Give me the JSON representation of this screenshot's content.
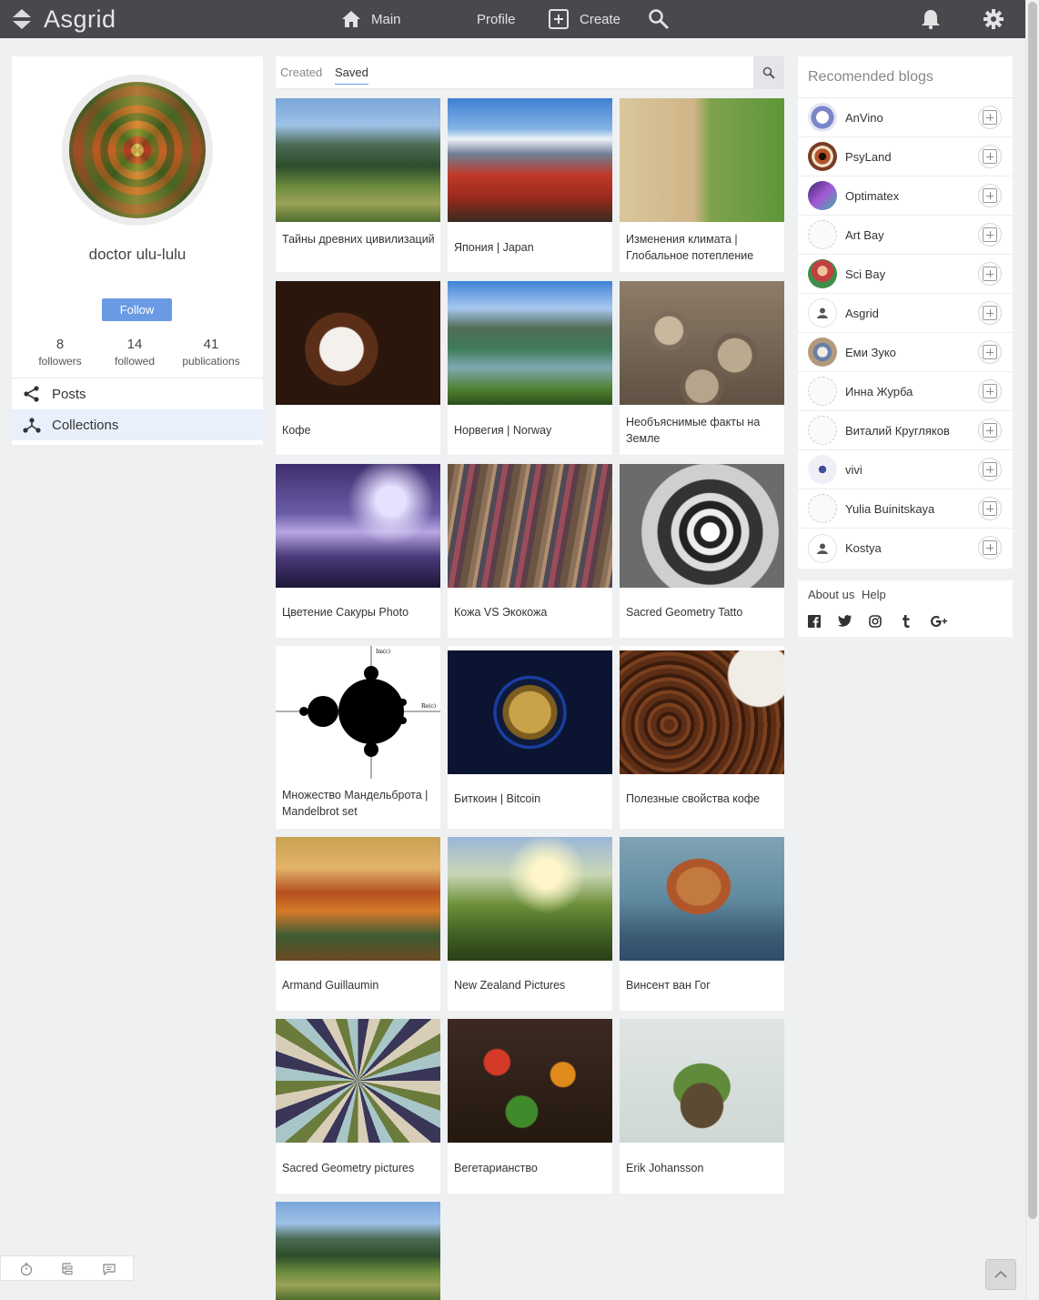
{
  "app": {
    "name": "Asgrid"
  },
  "nav": {
    "main": "Main",
    "profile": "Profile",
    "create": "Create"
  },
  "profile": {
    "name": "doctor ulu-lulu",
    "follow_label": "Follow",
    "stats": [
      {
        "num": "8",
        "label": "followers"
      },
      {
        "num": "14",
        "label": "followed"
      },
      {
        "num": "41",
        "label": "publications"
      }
    ],
    "menu": [
      {
        "label": "Posts",
        "active": false
      },
      {
        "label": "Collections",
        "active": true
      }
    ]
  },
  "tabs": {
    "created": "Created",
    "saved": "Saved",
    "active": "Saved"
  },
  "collections": [
    {
      "caption": "Тайны древних цивилизаций",
      "art": "machu"
    },
    {
      "caption": "Япония | Japan",
      "art": "fuji"
    },
    {
      "caption": "Изменения климата | Глобальное потепление",
      "art": "climate"
    },
    {
      "caption": "Кофе",
      "art": "coffee"
    },
    {
      "caption": "Норвегия | Norway",
      "art": "norway"
    },
    {
      "caption": "Необъяснимые факты на Земле",
      "art": "stones"
    },
    {
      "caption": "Цветение Сакуры Photo",
      "art": "sakura"
    },
    {
      "caption": "Кожа VS Экокожа",
      "art": "leather"
    },
    {
      "caption": "Sacred Geometry Tatto",
      "art": "tattoo"
    },
    {
      "caption": "Множество Мандельброта | Mandelbrot set",
      "art": "mandel"
    },
    {
      "caption": "Биткоин | Bitcoin",
      "art": "bitcoin"
    },
    {
      "caption": "Полезные свойства кофе",
      "art": "beans"
    },
    {
      "caption": "Armand Guillaumin",
      "art": "armand"
    },
    {
      "caption": "New Zealand Pictures",
      "art": "nz"
    },
    {
      "caption": "Винсент ван Гог",
      "art": "vangogh"
    },
    {
      "caption": "Sacred Geometry pictures",
      "art": "geom"
    },
    {
      "caption": "Вегетарианство",
      "art": "veg"
    },
    {
      "caption": "Erik Johansson",
      "art": "erik"
    },
    {
      "caption": "",
      "art": "machu"
    }
  ],
  "mandelbrot_axis": {
    "im": "Im(c)",
    "re": "Re(c)"
  },
  "recommended": {
    "title": "Recomended blogs",
    "blogs": [
      {
        "name": "AnVino",
        "avatar": "#7b86c9"
      },
      {
        "name": "PsyLand",
        "avatar": "#7a3c24"
      },
      {
        "name": "Optimatex",
        "avatar": "#7a44b0"
      },
      {
        "name": "Art Bay",
        "avatar": "#e8e8e8"
      },
      {
        "name": "Sci Bay",
        "avatar": "#c24040"
      },
      {
        "name": "Asgrid",
        "avatar": "#f2f2f2"
      },
      {
        "name": "Еми Зуко",
        "avatar": "#9b8a7a"
      },
      {
        "name": "Инна Журба",
        "avatar": "#e8e8e8"
      },
      {
        "name": "Виталий Кругляков",
        "avatar": "#e8e8e8"
      },
      {
        "name": "vivi",
        "avatar": "#d9d2e8"
      },
      {
        "name": "Yulia Buinitskaya",
        "avatar": "#e8e8e8"
      },
      {
        "name": "Kostya",
        "avatar": "#f2f2f2"
      }
    ]
  },
  "footer": {
    "links": [
      "About us",
      "Help"
    ],
    "social": [
      {
        "name": "facebook",
        "glyph": "f"
      },
      {
        "name": "twitter",
        "glyph": "🐦"
      },
      {
        "name": "instagram",
        "glyph": "◎"
      },
      {
        "name": "tumblr",
        "glyph": "t"
      },
      {
        "name": "google-plus",
        "glyph": "G+"
      }
    ]
  },
  "colors": {
    "topbar": "#47494d",
    "accent": "#6b9ae5",
    "background": "#eef0f2"
  }
}
